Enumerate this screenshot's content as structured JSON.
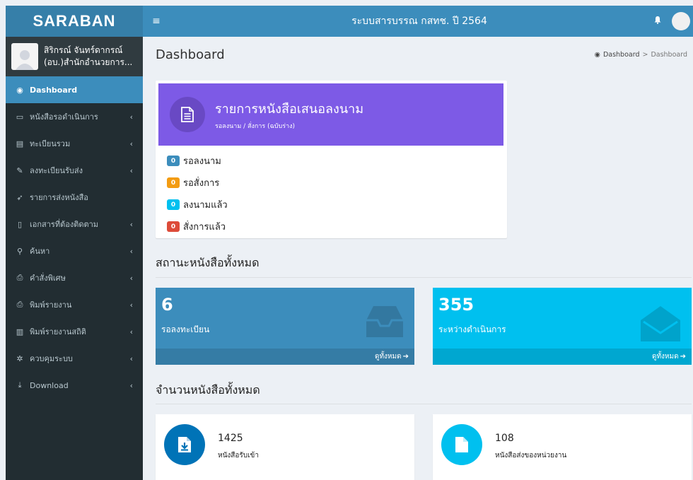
{
  "app": {
    "logo": "SARABAN",
    "title": "ระบบสารบรรณ กสทช. ปี 2564"
  },
  "user": {
    "name": "สิริกรณ์ จันทร์ดากรณ์",
    "department": "(อบ.)สำนักอำนวยการ..."
  },
  "sidebar": {
    "items": [
      {
        "label": "Dashboard",
        "icon": "dashboard-icon",
        "glyph": "◉",
        "active": true,
        "chevron": false
      },
      {
        "label": "หนังสือรอดำเนินการ",
        "icon": "inbox-icon",
        "glyph": "▭",
        "active": false,
        "chevron": true
      },
      {
        "label": "ทะเบียนรวม",
        "icon": "book-icon",
        "glyph": "▤",
        "active": false,
        "chevron": true
      },
      {
        "label": "ลงทะเบียนรับส่ง",
        "icon": "edit-icon",
        "glyph": "✎",
        "active": false,
        "chevron": true
      },
      {
        "label": "รายการส่งหนังสือ",
        "icon": "send-icon",
        "glyph": "➶",
        "active": false,
        "chevron": false
      },
      {
        "label": "เอกสารที่ต้องติดตาม",
        "icon": "bookmark-icon",
        "glyph": "▯",
        "active": false,
        "chevron": true
      },
      {
        "label": "ค้นหา",
        "icon": "search-icon",
        "glyph": "⚲",
        "active": false,
        "chevron": true
      },
      {
        "label": "คำสั่งพิเศษ",
        "icon": "print-icon",
        "glyph": "⎙",
        "active": false,
        "chevron": true
      },
      {
        "label": "พิมพ์รายงาน",
        "icon": "print-icon",
        "glyph": "⎙",
        "active": false,
        "chevron": true
      },
      {
        "label": "พิมพ์รายงานสถิติ",
        "icon": "bar-chart-icon",
        "glyph": "▥",
        "active": false,
        "chevron": true
      },
      {
        "label": "ควบคุมระบบ",
        "icon": "gear-icon",
        "glyph": "✲",
        "active": false,
        "chevron": true
      },
      {
        "label": "Download",
        "icon": "download-icon",
        "glyph": "⤓",
        "active": false,
        "chevron": true
      }
    ]
  },
  "header": {
    "page_title": "Dashboard",
    "breadcrumb": [
      "Dashboard",
      ">",
      "Dashboard"
    ]
  },
  "sign_box": {
    "title": "รายการหนังสือเสนอลงนาม",
    "subtitle": "รอลงนาม / สั่งการ (ฉบับร่าง)",
    "items": [
      {
        "count": "0",
        "label": "รอลงนาม",
        "color": "#3c8dbc"
      },
      {
        "count": "0",
        "label": "รอสั่งการ",
        "color": "#f39c12"
      },
      {
        "count": "0",
        "label": "ลงนามแล้ว",
        "color": "#00c0ef"
      },
      {
        "count": "0",
        "label": "สั่งการแล้ว",
        "color": "#dd4b39"
      }
    ]
  },
  "status_section": {
    "title": "สถานะหนังสือทั้งหมด",
    "cards": [
      {
        "number": "6",
        "label": "รอลงทะเบียน",
        "link": "ดูทั้งหมด",
        "bg": "#3c8dbc",
        "foot": "#357ca5",
        "icon": "inbox-tray-icon"
      },
      {
        "number": "355",
        "label": "ระหว่างดำเนินการ",
        "link": "ดูทั้งหมด",
        "bg": "#00c0ef",
        "foot": "#00a7d0",
        "icon": "open-envelope-icon"
      }
    ]
  },
  "count_section": {
    "title": "จำนวนหนังสือทั้งหมด",
    "boxes": [
      {
        "number": "1425",
        "label": "หนังสือรับเข้า",
        "color": "#0073b7",
        "icon": "file-download-icon"
      },
      {
        "number": "108",
        "label": "หนังสือส่งของหน่วยงาน",
        "color": "#00c0ef",
        "icon": "file-icon"
      }
    ]
  }
}
